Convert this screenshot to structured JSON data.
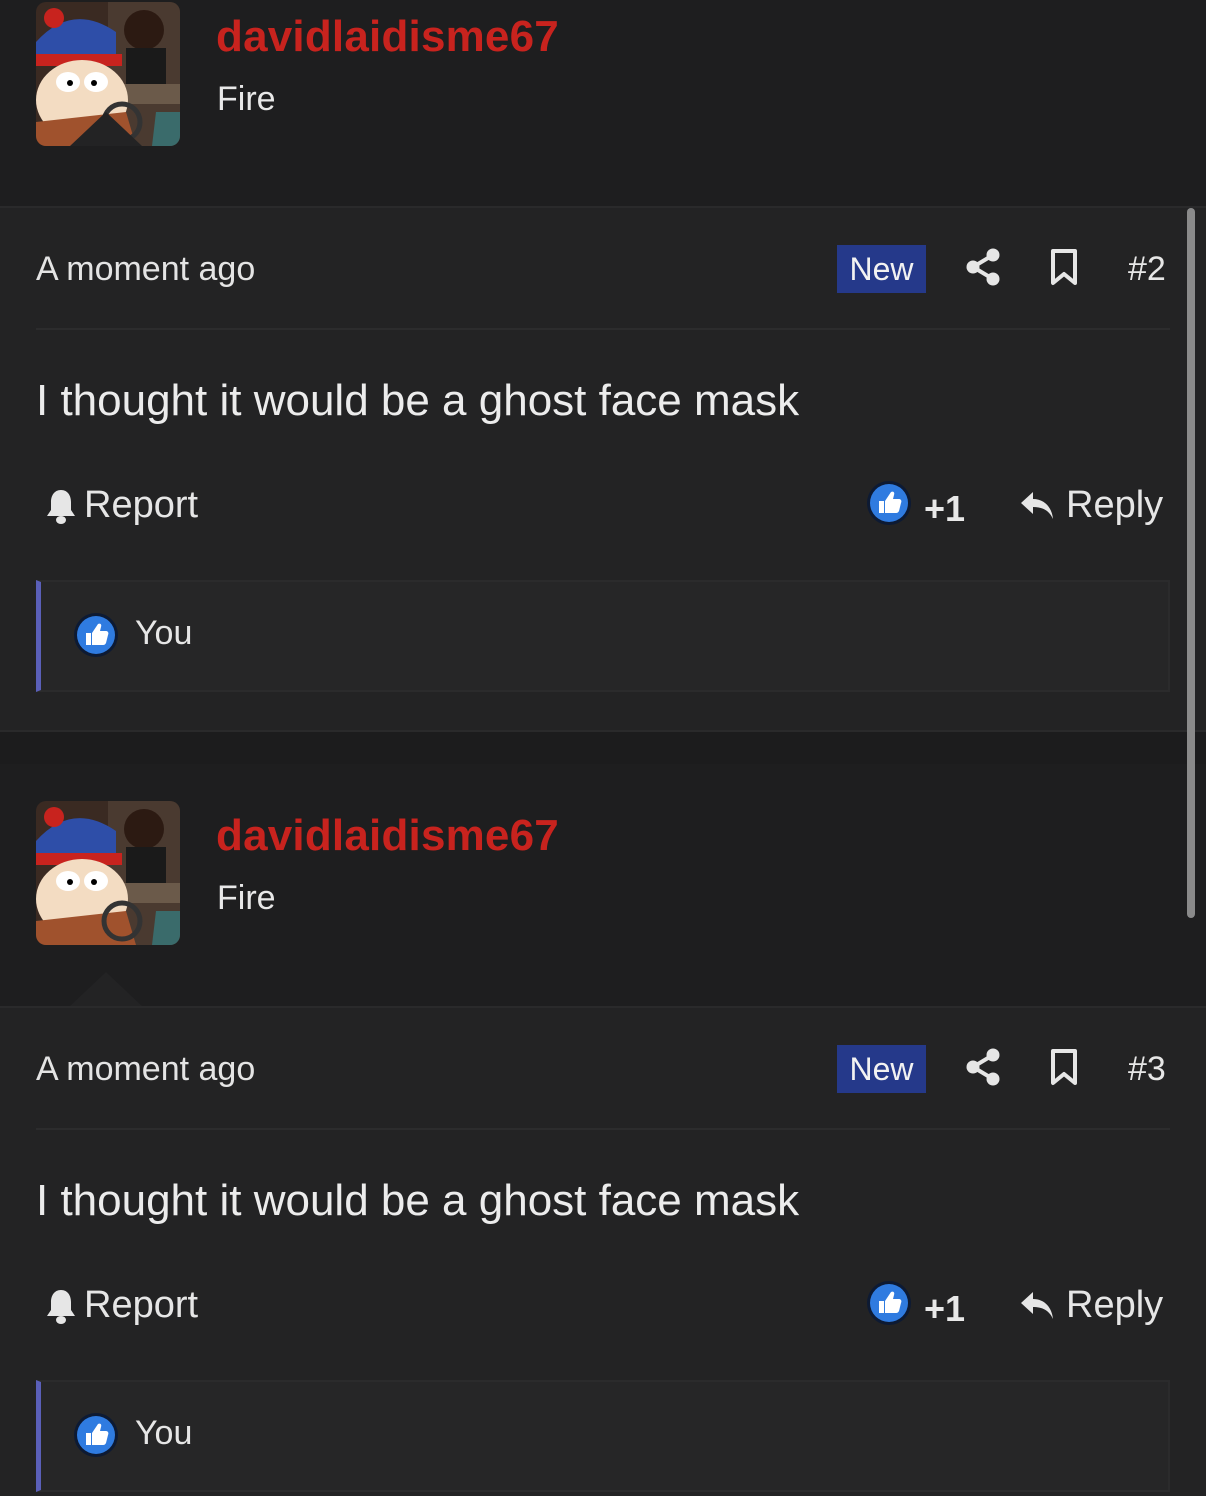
{
  "posts": [
    {
      "username": "davidlaidisme67",
      "user_title": "Fire",
      "timestamp": "A moment ago",
      "badge": "New",
      "post_number": "#2",
      "message": "I thought it would be a ghost face mask",
      "report_label": "Report",
      "like_count": "+1",
      "reply_label": "Reply",
      "reactions": [
        {
          "name": "You"
        }
      ]
    },
    {
      "username": "davidlaidisme67",
      "user_title": "Fire",
      "timestamp": "A moment ago",
      "badge": "New",
      "post_number": "#3",
      "message": "I thought it would be a ghost face mask",
      "report_label": "Report",
      "like_count": "+1",
      "reply_label": "Reply",
      "reactions": [
        {
          "name": "You"
        }
      ]
    }
  ],
  "icons": {
    "share": "share-icon",
    "bookmark": "bookmark-icon",
    "report": "bell-icon",
    "like": "thumbs-up-icon",
    "reply": "reply-arrow-icon"
  },
  "colors": {
    "username": "#c8231e",
    "badge_new": "#25398a",
    "like_blue": "#2f7be0",
    "reaction_accent": "#5a5fb8"
  }
}
